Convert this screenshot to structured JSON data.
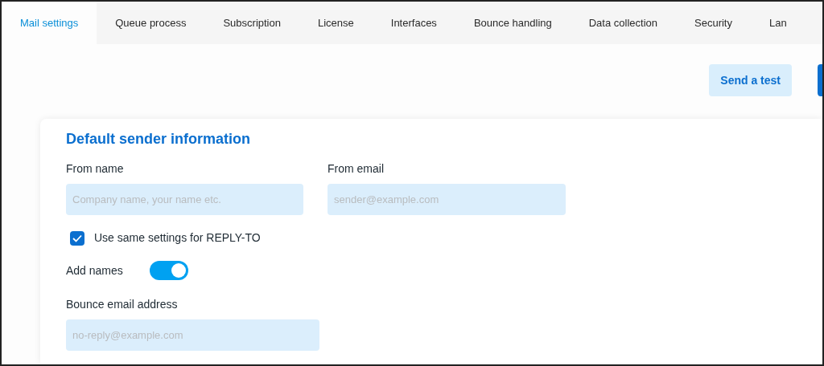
{
  "tabs": [
    {
      "label": "Mail settings",
      "selected": true
    },
    {
      "label": "Queue process",
      "selected": false
    },
    {
      "label": "Subscription",
      "selected": false
    },
    {
      "label": "License",
      "selected": false
    },
    {
      "label": "Interfaces",
      "selected": false
    },
    {
      "label": "Bounce handling",
      "selected": false
    },
    {
      "label": "Data collection",
      "selected": false
    },
    {
      "label": "Security",
      "selected": false
    },
    {
      "label": "Lan",
      "selected": false
    }
  ],
  "toolbar": {
    "send_test_button": "Send a test"
  },
  "card": {
    "title": "Default sender information",
    "from_name": {
      "label": "From name",
      "placeholder": "Company name, your name etc."
    },
    "from_email": {
      "label": "From email",
      "placeholder": "sender@example.com"
    },
    "reply_to": {
      "label": "Use same settings for REPLY-TO",
      "checked": true
    },
    "add_names": {
      "label": "Add names",
      "on": true
    },
    "bounce_email": {
      "label": "Bounce email address",
      "placeholder": "no-reply@example.com"
    }
  }
}
